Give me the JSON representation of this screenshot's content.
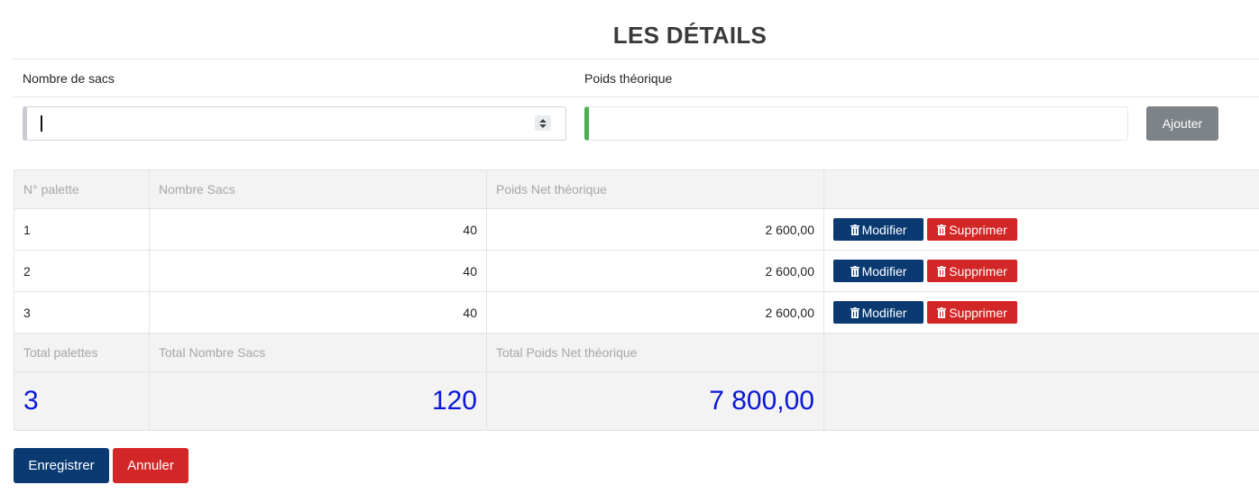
{
  "title": "LES DÉTAILS",
  "form": {
    "bags_label": "Nombre de sacs",
    "weight_label": "Poids théorique",
    "bags_value": "",
    "weight_value": "",
    "add_label": "Ajouter"
  },
  "table": {
    "headers": [
      "N° palette",
      "Nombre Sacs",
      "Poids Net théorique",
      ""
    ],
    "rows": [
      {
        "palette": "1",
        "sacs": "40",
        "poids": "2 600,00"
      },
      {
        "palette": "2",
        "sacs": "40",
        "poids": "2 600,00"
      },
      {
        "palette": "3",
        "sacs": "40",
        "poids": "2 600,00"
      }
    ],
    "edit_label": "Modifier",
    "delete_label": "Supprimer",
    "total_headers": [
      "Total palettes",
      "Total Nombre Sacs",
      "Total Poids Net théorique"
    ],
    "totals": {
      "palettes": "3",
      "sacs": "120",
      "poids": "7 800,00"
    }
  },
  "footer": {
    "save_label": "Enregistrer",
    "cancel_label": "Annuler"
  },
  "colors": {
    "primary": "#0b3a73",
    "danger": "#d32627",
    "secondary": "#7d8388",
    "total_text": "#0a16d8",
    "input_valid": "#4caf50"
  }
}
